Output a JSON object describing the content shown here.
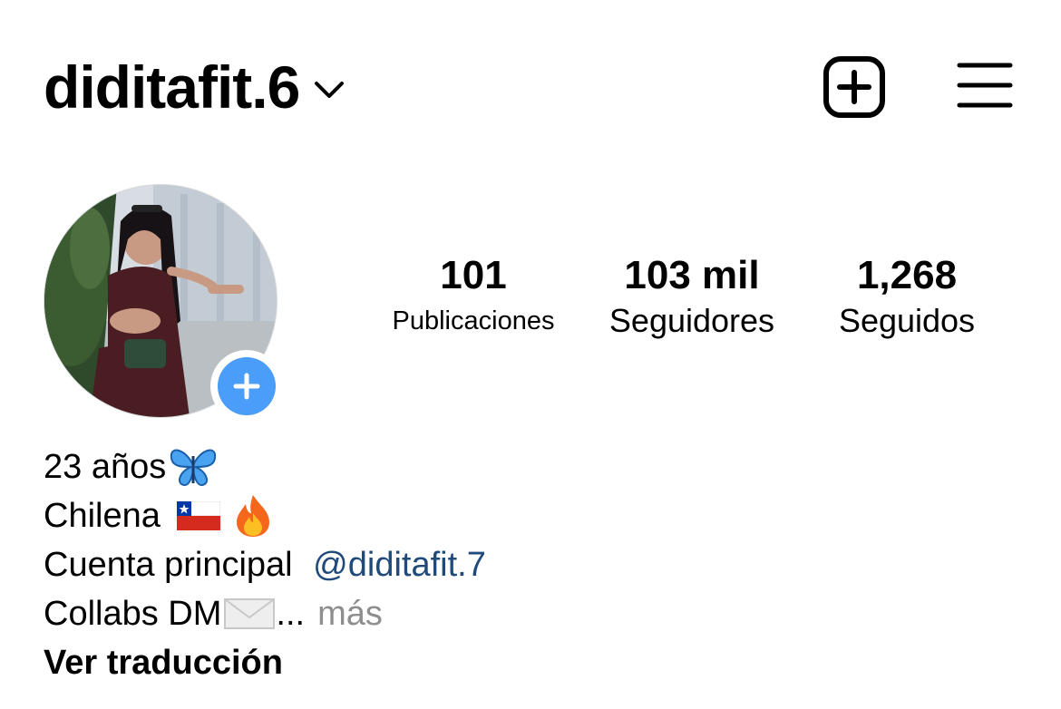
{
  "header": {
    "username": "diditafit.6",
    "icons": {
      "dropdown": "chevron-down-icon",
      "new_post": "plus-square-icon",
      "menu": "hamburger-menu-icon"
    }
  },
  "profile": {
    "avatar_icon": "profile-photo",
    "add_story_icon": "plus-circle-icon",
    "accent_color": "#4a9df8"
  },
  "stats": {
    "posts": {
      "value": "101",
      "label": "Publicaciones"
    },
    "followers": {
      "value": "103 mil",
      "label": "Seguidores"
    },
    "following": {
      "value": "1,268",
      "label": "Seguidos"
    }
  },
  "bio": {
    "line1": "23 años",
    "line2": "Chilena",
    "line3_prefix": "Cuenta principal ",
    "line3_mention": "@diditafit.7",
    "line4": "Collabs DM",
    "line4_ellipsis": "...",
    "more": "más",
    "translate": "Ver traducción",
    "emoji_icons": [
      "butterfly-icon",
      "chile-flag-icon",
      "fire-icon",
      "envelope-icon"
    ],
    "mention_color": "#1f4a7a",
    "more_color": "#8e8e8e"
  }
}
